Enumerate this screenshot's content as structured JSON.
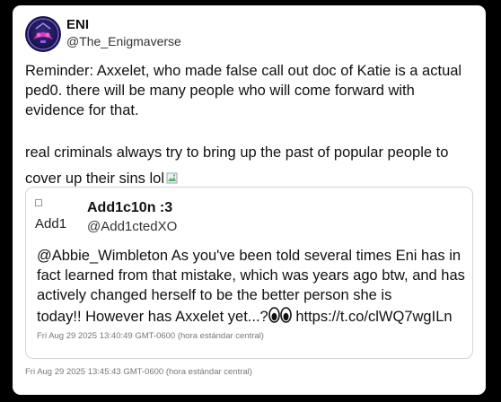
{
  "tweet": {
    "author_name": "ENI",
    "author_handle": "@The_Enigmaverse",
    "text_p1": "Reminder: Axxelet, who made false call out doc of Katie is a actual ped0. there will be many people who will come forward with evidence for that.",
    "text_p2": "real criminals always try to bring up the past of popular people to cover up their sins lol",
    "timestamp": "Fri Aug 29 2025 13:45:43 GMT-0600 (hora estándar central)"
  },
  "quoted": {
    "avatar_alt": "Add1",
    "author_name": "Add1c10n :3",
    "author_handle": "@Add1ctedXO",
    "text_main": "@Abbie_Wimbleton As you've been told several times Eni has in fact learned from that mistake, which was years ago btw, and has actively changed herself to be the better person she is",
    "text_last": "today!! However has Axxelet yet...?",
    "link": "https://t.co/clWQ7wgILn",
    "timestamp": "Fri Aug 29 2025 13:40:49 GMT-0600 (hora estándar central)"
  },
  "icons": {
    "avatar": "eni-logo-avatar",
    "broken_emoji": "broken-image-icon",
    "eyes": "eyes-emoji-icon"
  },
  "colors": {
    "background": "#000000",
    "card": "#ffffff",
    "quote_border": "#cfd6dc",
    "timestamp": "#777777"
  }
}
